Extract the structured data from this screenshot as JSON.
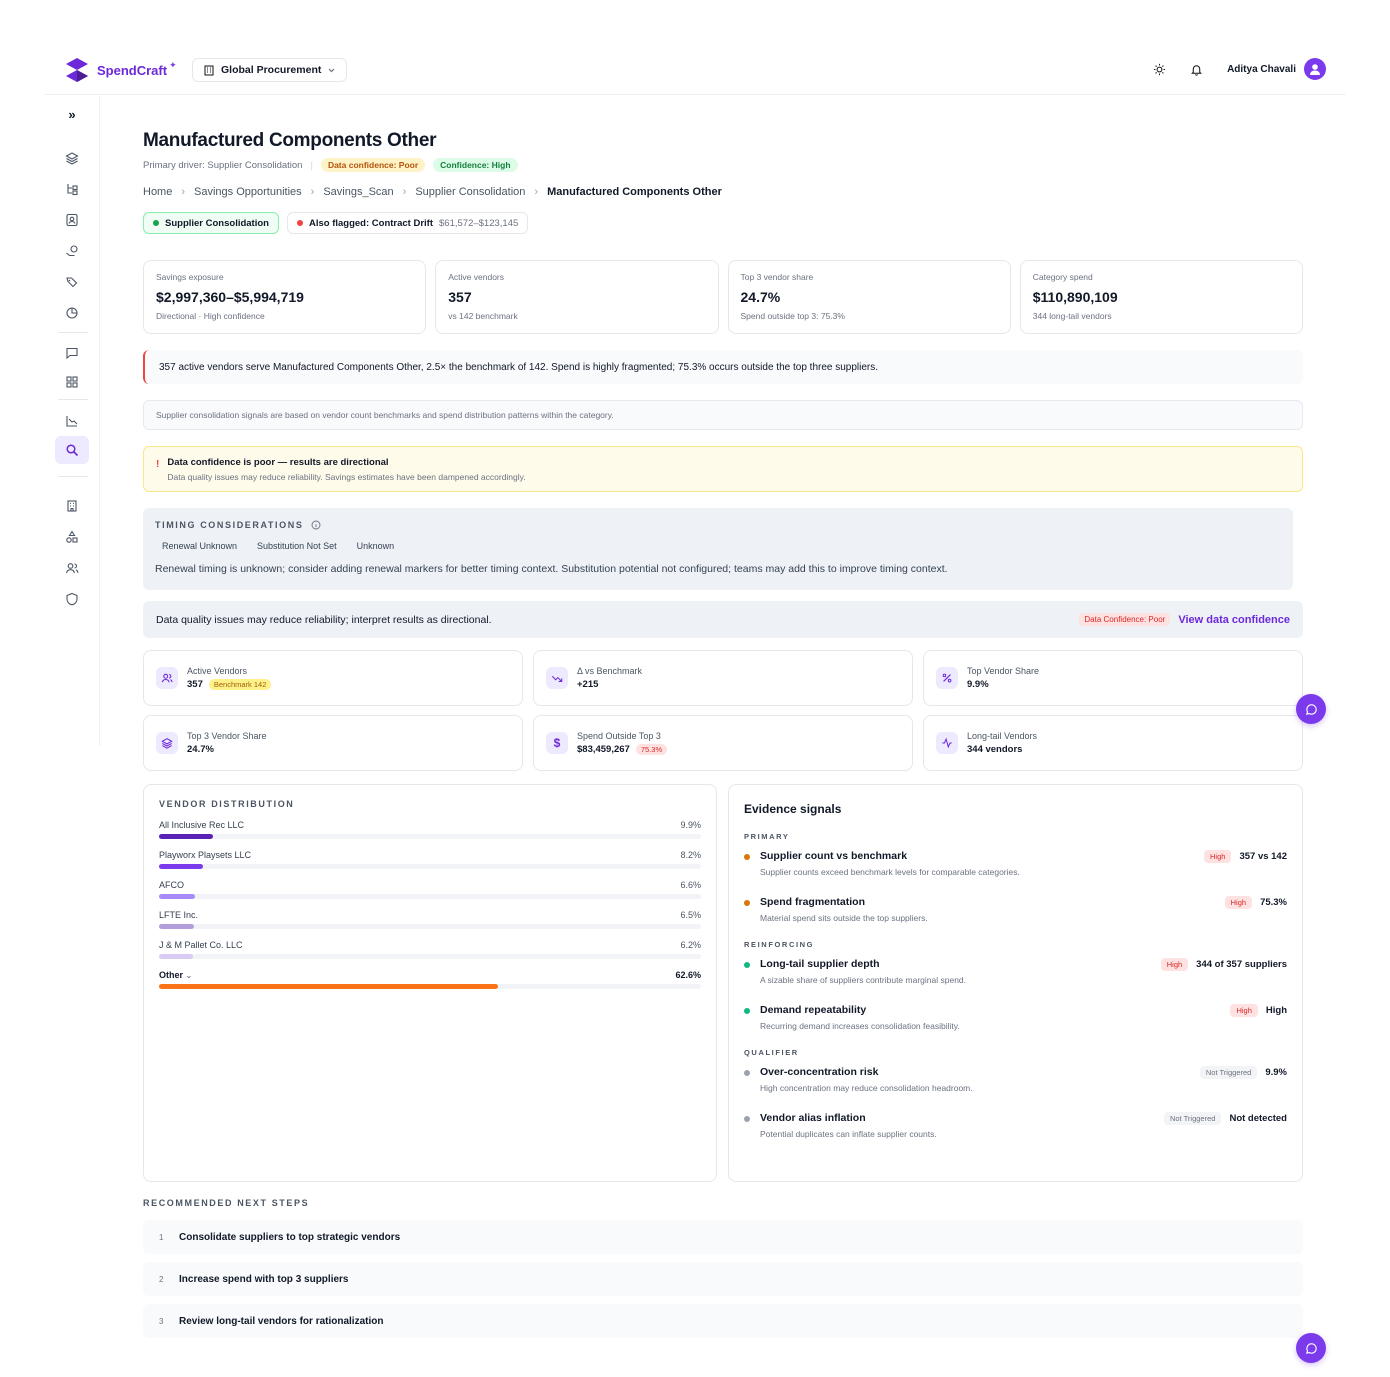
{
  "app": {
    "name": "SpendCraft",
    "workspace": "Global Procurement",
    "user": "Aditya Chavali"
  },
  "page": {
    "title": "Manufactured Components Other",
    "primary_driver": "Primary driver: Supplier Consolidation",
    "data_confidence": "Data confidence: Poor",
    "confidence": "Confidence: High"
  },
  "breadcrumbs": [
    "Home",
    "Savings Opportunities",
    "Savings_Scan",
    "Supplier Consolidation",
    "Manufactured Components Other"
  ],
  "tags": {
    "primary": "Supplier Consolidation",
    "also_flagged": "Also flagged: Contract Drift",
    "also_range": "$61,572–$123,145"
  },
  "kpis": [
    {
      "label": "Savings exposure",
      "value": "$2,997,360–$5,994,719",
      "sub": "Directional · High confidence"
    },
    {
      "label": "Active vendors",
      "value": "357",
      "sub": "vs 142 benchmark"
    },
    {
      "label": "Top 3 vendor share",
      "value": "24.7%",
      "sub": "Spend outside top 3: 75.3%"
    },
    {
      "label": "Category spend",
      "value": "$110,890,109",
      "sub": "344 long-tail vendors"
    }
  ],
  "insight": "357 active vendors serve Manufactured Components Other, 2.5× the benchmark of 142. Spend is highly fragmented; 75.3% occurs outside the top three suppliers.",
  "note": "Supplier consolidation signals are based on vendor count benchmarks and spend distribution patterns within the category.",
  "warning": {
    "title": "Data confidence is poor — results are directional",
    "desc": "Data quality issues may reduce reliability. Savings estimates have been dampened accordingly."
  },
  "timing": {
    "label": "TIMING CONSIDERATIONS",
    "chips": [
      "Renewal Unknown",
      "Substitution Not Set",
      "Unknown"
    ],
    "text": "Renewal timing is unknown; consider adding renewal markers for better timing context. Substitution potential not configured; teams may add this to improve timing context."
  },
  "data_quality": {
    "text": "Data quality issues may reduce reliability; interpret results as directional.",
    "badge": "Data Confidence: Poor",
    "link": "View data confidence"
  },
  "metrics": [
    {
      "label": "Active Vendors",
      "value": "357",
      "badge": "Benchmark 142",
      "icon": "users-icon"
    },
    {
      "label": "Δ vs Benchmark",
      "value": "+215",
      "badge": "",
      "icon": "trend-down-icon"
    },
    {
      "label": "Top Vendor Share",
      "value": "9.9%",
      "badge": "",
      "icon": "percent-icon"
    },
    {
      "label": "Top 3 Vendor Share",
      "value": "24.7%",
      "badge": "",
      "icon": "layers-icon"
    },
    {
      "label": "Spend Outside Top 3",
      "value": "$83,459,267",
      "badge": "75.3%",
      "icon": "dollar-icon"
    },
    {
      "label": "Long-tail Vendors",
      "value": "344 vendors",
      "badge": "",
      "icon": "activity-icon"
    }
  ],
  "vendor_distribution": {
    "label": "VENDOR DISTRIBUTION",
    "vendors": [
      {
        "name": "All Inclusive Rec LLC",
        "pct": "9.9%",
        "share": 9.9,
        "color": "#5b21b6"
      },
      {
        "name": "Playworx Playsets LLC",
        "pct": "8.2%",
        "share": 8.2,
        "color": "#7c3aed"
      },
      {
        "name": "AFCO",
        "pct": "6.6%",
        "share": 6.6,
        "color": "#a78bfa"
      },
      {
        "name": "LFTE Inc.",
        "pct": "6.5%",
        "share": 6.5,
        "color": "#b39ddb"
      },
      {
        "name": "J & M Pallet Co. LLC",
        "pct": "6.2%",
        "share": 6.2,
        "color": "#d8ccf5"
      }
    ],
    "other": {
      "name": "Other",
      "pct": "62.6%",
      "share": 62.6,
      "color": "#f97316"
    }
  },
  "evidence": {
    "title": "Evidence signals",
    "groups": [
      {
        "label": "PRIMARY",
        "items": [
          {
            "title": "Supplier count vs benchmark",
            "desc": "Supplier counts exceed benchmark levels for comparable categories.",
            "badge": "High",
            "value": "357 vs 142",
            "color": "#d97706"
          },
          {
            "title": "Spend fragmentation",
            "desc": "Material spend sits outside the top suppliers.",
            "badge": "High",
            "value": "75.3%",
            "color": "#d97706"
          }
        ]
      },
      {
        "label": "REINFORCING",
        "items": [
          {
            "title": "Long-tail supplier depth",
            "desc": "A sizable share of suppliers contribute marginal spend.",
            "badge": "High",
            "value": "344 of 357 suppliers",
            "color": "#10b981"
          },
          {
            "title": "Demand repeatability",
            "desc": "Recurring demand increases consolidation feasibility.",
            "badge": "High",
            "value": "High",
            "color": "#10b981"
          }
        ]
      },
      {
        "label": "QUALIFIER",
        "items": [
          {
            "title": "Over-concentration risk",
            "desc": "High concentration may reduce consolidation headroom.",
            "badge": "Not Triggered",
            "value": "9.9%",
            "color": "#9ca3af"
          },
          {
            "title": "Vendor alias inflation",
            "desc": "Potential duplicates can inflate supplier counts.",
            "badge": "Not Triggered",
            "value": "Not detected",
            "color": "#9ca3af"
          }
        ]
      }
    ]
  },
  "next_steps": {
    "label": "RECOMMENDED NEXT STEPS",
    "items": [
      {
        "n": "1",
        "text": "Consolidate suppliers to top strategic vendors"
      },
      {
        "n": "2",
        "text": "Increase spend with top 3 suppliers"
      },
      {
        "n": "3",
        "text": "Review long-tail vendors for rationalization"
      }
    ]
  }
}
